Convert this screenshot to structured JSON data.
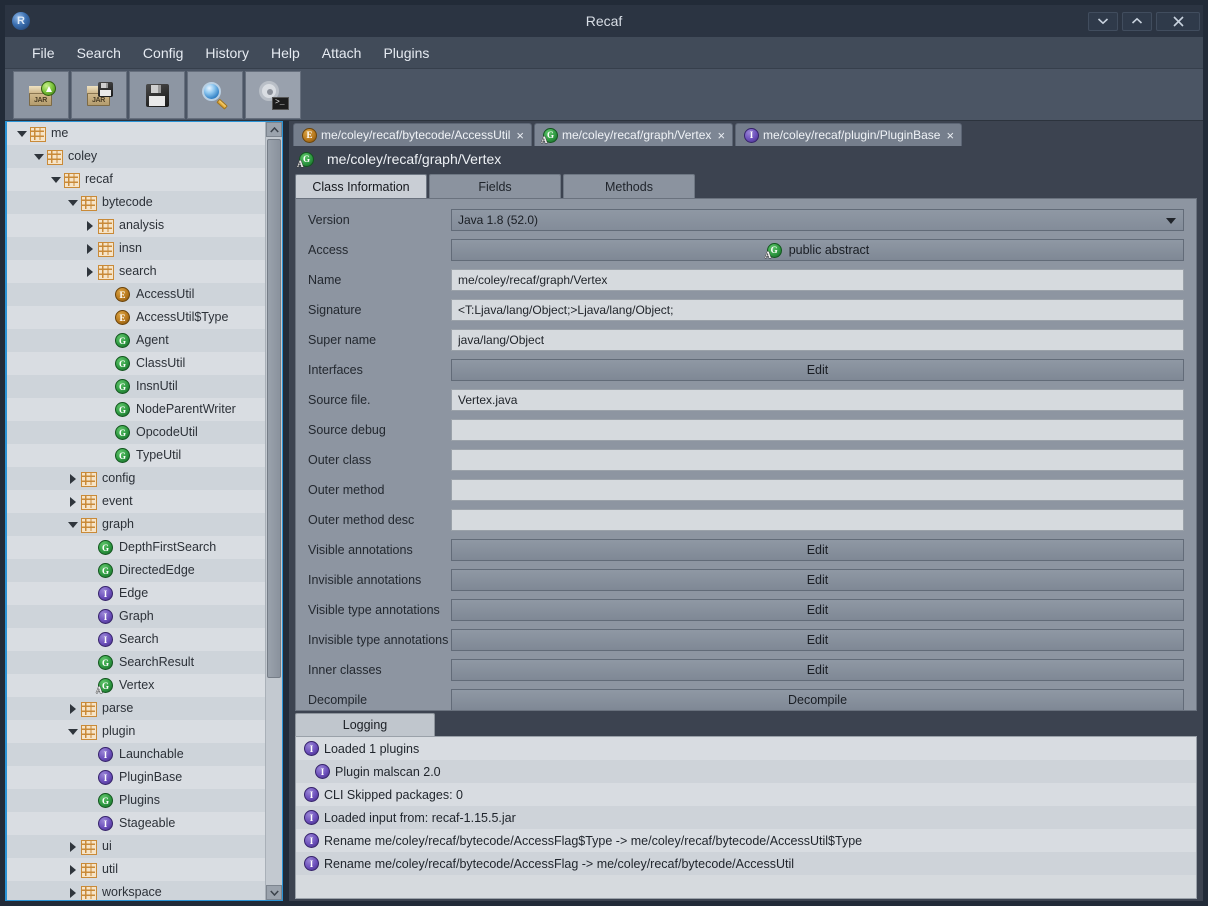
{
  "window": {
    "title": "Recaf",
    "logo_icon": "recaf-logo-icon",
    "buttons": [
      {
        "name": "minimize-button",
        "icon": "chevron-down-icon",
        "label": "⌄"
      },
      {
        "name": "maximize-button",
        "icon": "chevron-up-icon",
        "label": "⌃"
      },
      {
        "name": "close-button",
        "icon": "close-icon",
        "label": "×"
      }
    ]
  },
  "menubar": {
    "items": [
      {
        "label": "File"
      },
      {
        "label": "Search"
      },
      {
        "label": "Config"
      },
      {
        "label": "History"
      },
      {
        "label": "Help"
      },
      {
        "label": "Attach"
      },
      {
        "label": "Plugins"
      }
    ]
  },
  "toolbar": {
    "buttons": [
      {
        "name": "load-jar-button",
        "icon": "jar-open-icon"
      },
      {
        "name": "save-jar-button",
        "icon": "jar-save-icon"
      },
      {
        "name": "save-button",
        "icon": "floppy-disk-icon"
      },
      {
        "name": "search-button",
        "icon": "magnifier-icon"
      },
      {
        "name": "config-terminal-button",
        "icon": "gear-terminal-icon"
      }
    ]
  },
  "tree": {
    "nodes": [
      {
        "label": "me",
        "depth": 0,
        "type": "package",
        "state": "open"
      },
      {
        "label": "coley",
        "depth": 1,
        "type": "package",
        "state": "open"
      },
      {
        "label": "recaf",
        "depth": 2,
        "type": "package",
        "state": "open"
      },
      {
        "label": "bytecode",
        "depth": 3,
        "type": "package",
        "state": "open"
      },
      {
        "label": "analysis",
        "depth": 4,
        "type": "package",
        "state": "closed"
      },
      {
        "label": "insn",
        "depth": 4,
        "type": "package",
        "state": "closed"
      },
      {
        "label": "search",
        "depth": 4,
        "type": "package",
        "state": "closed"
      },
      {
        "label": "AccessUtil",
        "depth": 5,
        "type": "enum",
        "state": "leaf"
      },
      {
        "label": "AccessUtil$Type",
        "depth": 5,
        "type": "enum",
        "state": "leaf"
      },
      {
        "label": "Agent",
        "depth": 5,
        "type": "class",
        "state": "leaf"
      },
      {
        "label": "ClassUtil",
        "depth": 5,
        "type": "class",
        "state": "leaf"
      },
      {
        "label": "InsnUtil",
        "depth": 5,
        "type": "class",
        "state": "leaf"
      },
      {
        "label": "NodeParentWriter",
        "depth": 5,
        "type": "class",
        "state": "leaf"
      },
      {
        "label": "OpcodeUtil",
        "depth": 5,
        "type": "class",
        "state": "leaf"
      },
      {
        "label": "TypeUtil",
        "depth": 5,
        "type": "class",
        "state": "leaf"
      },
      {
        "label": "config",
        "depth": 3,
        "type": "package",
        "state": "closed"
      },
      {
        "label": "event",
        "depth": 3,
        "type": "package",
        "state": "closed"
      },
      {
        "label": "graph",
        "depth": 3,
        "type": "package",
        "state": "open"
      },
      {
        "label": "DepthFirstSearch",
        "depth": 4,
        "type": "class",
        "state": "leaf"
      },
      {
        "label": "DirectedEdge",
        "depth": 4,
        "type": "class",
        "state": "leaf"
      },
      {
        "label": "Edge",
        "depth": 4,
        "type": "interface",
        "state": "leaf"
      },
      {
        "label": "Graph",
        "depth": 4,
        "type": "interface",
        "state": "leaf"
      },
      {
        "label": "Search",
        "depth": 4,
        "type": "interface",
        "state": "leaf"
      },
      {
        "label": "SearchResult",
        "depth": 4,
        "type": "class",
        "state": "leaf"
      },
      {
        "label": "Vertex",
        "depth": 4,
        "type": "abstract",
        "state": "leaf"
      },
      {
        "label": "parse",
        "depth": 3,
        "type": "package",
        "state": "closed"
      },
      {
        "label": "plugin",
        "depth": 3,
        "type": "package",
        "state": "open"
      },
      {
        "label": "Launchable",
        "depth": 4,
        "type": "interface",
        "state": "leaf"
      },
      {
        "label": "PluginBase",
        "depth": 4,
        "type": "interface",
        "state": "leaf"
      },
      {
        "label": "Plugins",
        "depth": 4,
        "type": "class",
        "state": "leaf"
      },
      {
        "label": "Stageable",
        "depth": 4,
        "type": "interface",
        "state": "leaf"
      },
      {
        "label": "ui",
        "depth": 3,
        "type": "package",
        "state": "closed"
      },
      {
        "label": "util",
        "depth": 3,
        "type": "package",
        "state": "closed"
      },
      {
        "label": "workspace",
        "depth": 3,
        "type": "package",
        "state": "closed"
      }
    ]
  },
  "editor_tabs": [
    {
      "label": "me/coley/recaf/bytecode/AccessUtil",
      "type": "enum",
      "active": false,
      "close": "×"
    },
    {
      "label": "me/coley/recaf/graph/Vertex",
      "type": "abstract",
      "active": true,
      "close": "×"
    },
    {
      "label": "me/coley/recaf/plugin/PluginBase",
      "type": "interface",
      "active": false,
      "close": "×"
    }
  ],
  "class_header": {
    "title": "me/coley/recaf/graph/Vertex",
    "icon": "abstract-class-icon"
  },
  "inner_tabs": [
    {
      "label": "Class Information",
      "active": true
    },
    {
      "label": "Fields",
      "active": false
    },
    {
      "label": "Methods",
      "active": false
    }
  ],
  "form": {
    "rows": [
      {
        "label": "Version",
        "kind": "combo",
        "value": "Java 1.8 (52.0)"
      },
      {
        "label": "Access",
        "kind": "button",
        "value": "public abstract",
        "icon": "abstract-class-icon"
      },
      {
        "label": "Name",
        "kind": "text",
        "value": "me/coley/recaf/graph/Vertex"
      },
      {
        "label": "Signature",
        "kind": "text",
        "value": "<T:Ljava/lang/Object;>Ljava/lang/Object;"
      },
      {
        "label": "Super name",
        "kind": "text",
        "value": "java/lang/Object"
      },
      {
        "label": "Interfaces",
        "kind": "button",
        "value": "Edit"
      },
      {
        "label": "Source file.",
        "kind": "text",
        "value": "Vertex.java"
      },
      {
        "label": "Source debug",
        "kind": "text",
        "value": ""
      },
      {
        "label": "Outer class",
        "kind": "text",
        "value": ""
      },
      {
        "label": "Outer method",
        "kind": "text",
        "value": ""
      },
      {
        "label": "Outer method desc",
        "kind": "text",
        "value": ""
      },
      {
        "label": "Visible annotations",
        "kind": "button",
        "value": "Edit"
      },
      {
        "label": "Invisible annotations",
        "kind": "button",
        "value": "Edit"
      },
      {
        "label": "Visible type annotations",
        "kind": "button",
        "value": "Edit"
      },
      {
        "label": "Invisible type annotations",
        "kind": "button",
        "value": "Edit"
      },
      {
        "label": "Inner classes",
        "kind": "button",
        "value": "Edit"
      },
      {
        "label": "Decompile",
        "kind": "button",
        "value": "Decompile"
      }
    ]
  },
  "logging": {
    "tab_label": "Logging",
    "entries": [
      {
        "level": "info",
        "text": "Loaded 1 plugins",
        "indent": false
      },
      {
        "level": "info",
        "text": "Plugin malscan 2.0",
        "indent": true
      },
      {
        "level": "info",
        "text": "CLI Skipped packages: 0",
        "indent": false
      },
      {
        "level": "info",
        "text": "Loaded input from: recaf-1.15.5.jar",
        "indent": false
      },
      {
        "level": "info",
        "text": "Rename me/coley/recaf/bytecode/AccessFlag$Type -> me/coley/recaf/bytecode/AccessUtil$Type",
        "indent": false
      },
      {
        "level": "info",
        "text": "Rename me/coley/recaf/bytecode/AccessFlag -> me/coley/recaf/bytecode/AccessUtil",
        "indent": false
      }
    ]
  },
  "colors": {
    "titlebar": "#2b3442",
    "menubar": "#414b59",
    "toolbar": "#4b5564",
    "panel": "#3c4350",
    "form_bg": "#8d95a1",
    "field_bg": "#d6dade",
    "tree_bg": "#d4d9de",
    "tree_border": "#2a93d5",
    "enum_badge": "#b97a1e",
    "class_badge": "#2f9a42",
    "interface_badge": "#6c4fbb",
    "package_icon": "#c98a38"
  }
}
